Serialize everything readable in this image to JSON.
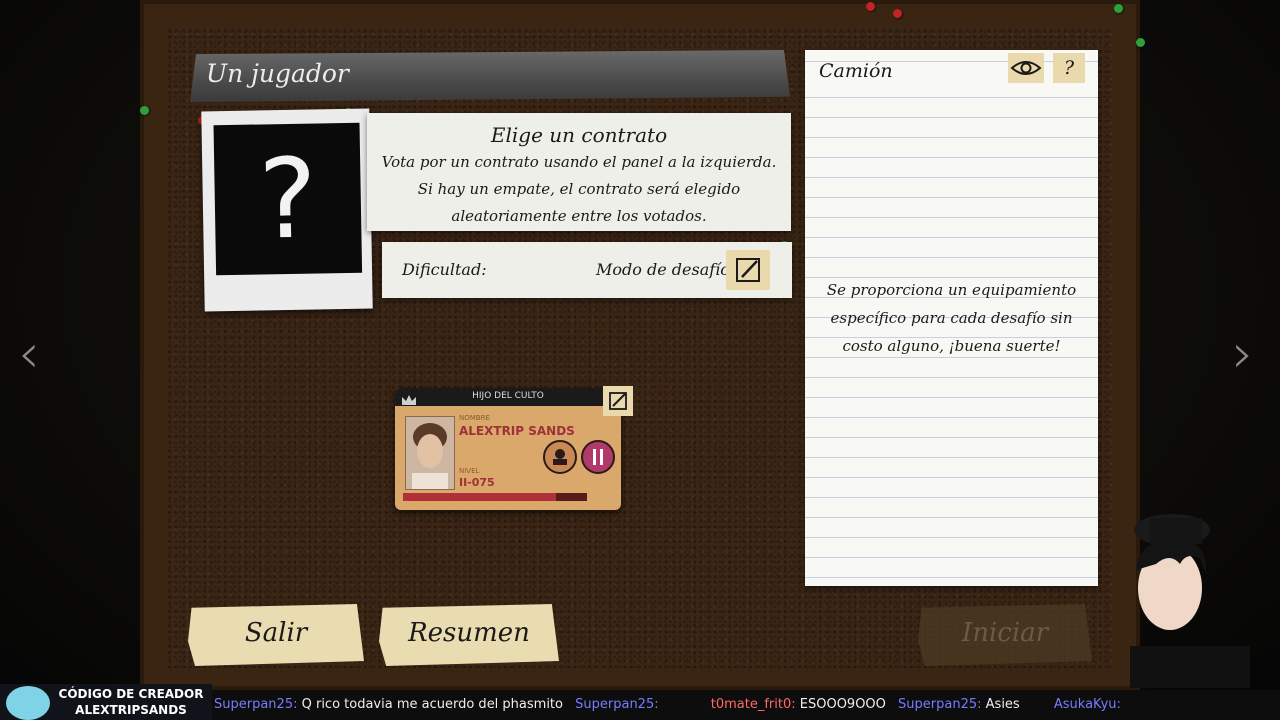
{
  "header": {
    "title": "Un jugador"
  },
  "contract": {
    "title": "Elige un contrato",
    "line1": "Vota por un contrato usando el panel a la izquierda.",
    "line2": "Si hay un empate, el contrato será elegido",
    "line3": "aleatoriamente entre los votados."
  },
  "photo": {
    "placeholder": "?"
  },
  "difficulty": {
    "label": "Dificultad:",
    "mode_label": "Modo de desafío"
  },
  "notes": {
    "title": "Camión",
    "help_label": "?",
    "line1": "Se proporciona un equipamiento",
    "line2": "específico para cada desafío sin",
    "line3": "costo alguno, ¡buena suerte!"
  },
  "player_card": {
    "role": "HIJO DEL CULTO",
    "name_label": "NOMBRE",
    "name": "ALEXTRIP SANDS",
    "level_label": "NIVEL",
    "level": "II-075",
    "xp_progress": 0.83
  },
  "buttons": {
    "exit": "Salir",
    "summary": "Resumen",
    "start": "Iniciar"
  },
  "overlay": {
    "creator_line1": "CÓDIGO DE CREADOR",
    "creator_line2": "ALEXTRIPSANDS",
    "chat": [
      {
        "user": "Superpan25:",
        "msg": "Q rico todavia me acuerdo del phasmito"
      },
      {
        "user": "Superpan25:",
        "msg": ""
      },
      {
        "user": "t0mate_frit0:",
        "msg": "ESOOO9OOO"
      },
      {
        "user": "Superpan25:",
        "msg": "Asies"
      },
      {
        "user": "AsukaKyu:",
        "msg": ""
      }
    ]
  },
  "colors": {
    "accent_red": "#c22323",
    "pin_green": "#2da03a",
    "tape_yellow": "#e9d9ad"
  }
}
